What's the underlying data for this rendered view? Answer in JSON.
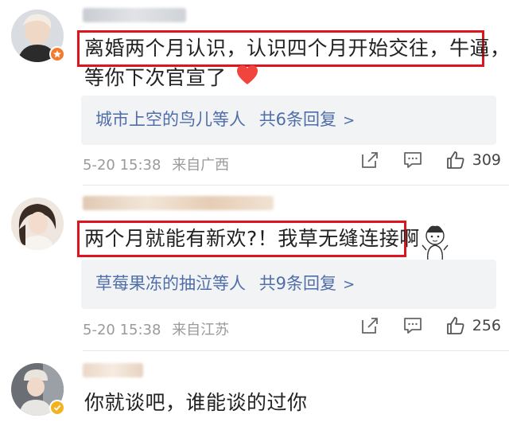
{
  "comments": [
    {
      "text_line1": "离婚两个月认识，认识四个月开始交往，牛逼，",
      "text_line2": "等你下次官宣了",
      "reply_users": "城市上空的鸟儿等人",
      "reply_count": "共6条回复",
      "chevron": ">",
      "date": "5-20 15:38",
      "location": "来自广西",
      "likes": "309"
    },
    {
      "text_line1": "两个月就能有新欢?！我草无缝连接啊",
      "reply_users": "草莓果冻的抽泣等人",
      "reply_count": "共9条回复",
      "chevron": ">",
      "date": "5-20 15:38",
      "location": "来自江苏",
      "likes": "256"
    },
    {
      "text_line1": "你就谈吧，谁能谈的过你"
    }
  ],
  "colors": {
    "highlight": "#e0141e",
    "link": "#4f6ea9",
    "meta": "#9a9a9a",
    "reply_bg": "#f2f3f5",
    "heart": "#f0443d"
  },
  "icons": [
    "heart-icon",
    "share-icon",
    "comment-icon",
    "like-icon",
    "vip-badge-icon",
    "verified-badge-icon"
  ]
}
